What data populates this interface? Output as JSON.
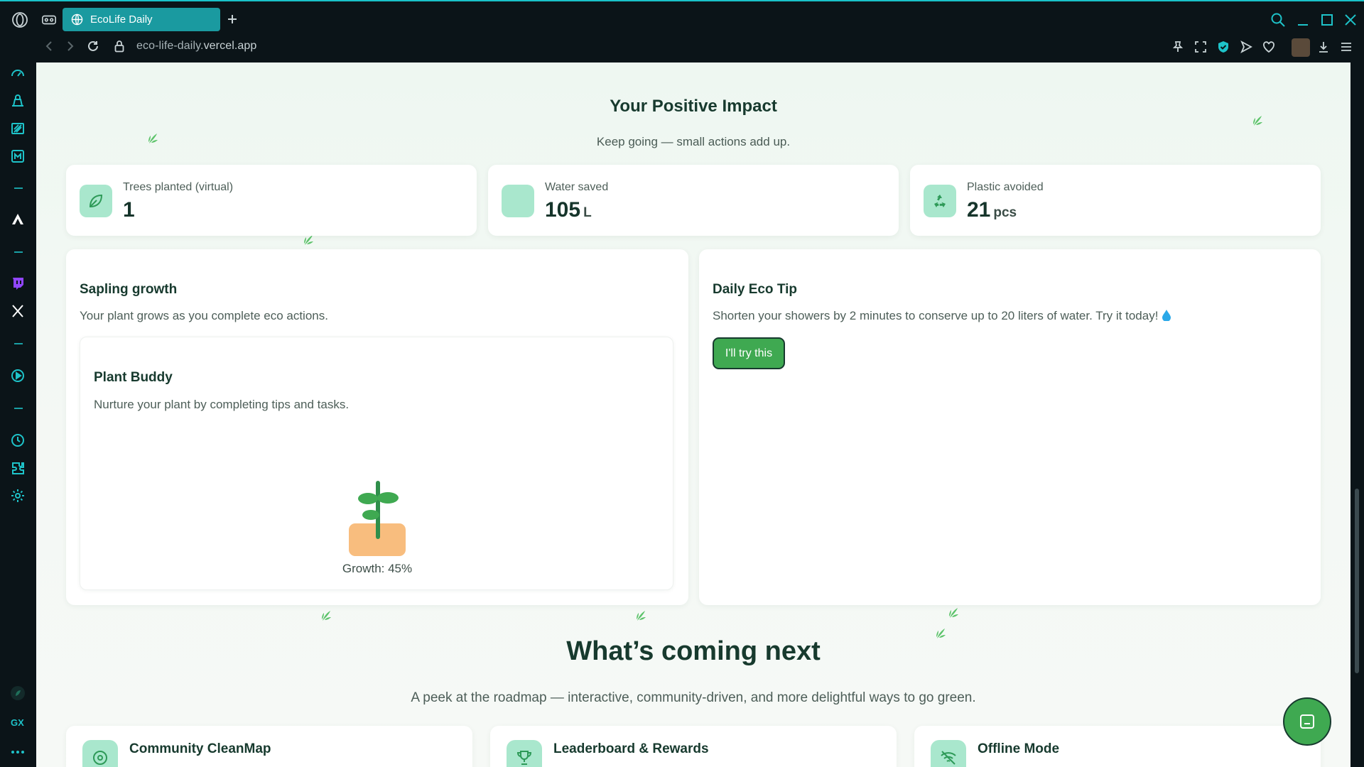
{
  "browser": {
    "tab_title": "EcoLife Daily",
    "url_host": "eco-life-daily.",
    "url_rest": "vercel.app"
  },
  "impact": {
    "title": "Your Positive Impact",
    "subtitle": "Keep going — small actions add up.",
    "stats": [
      {
        "label": "Trees planted (virtual)",
        "value": "1",
        "unit": "",
        "icon": "leaf-icon"
      },
      {
        "label": "Water saved",
        "value": "105",
        "unit": "L",
        "icon": "water-icon"
      },
      {
        "label": "Plastic avoided",
        "value": "21",
        "unit": "pcs",
        "icon": "recycle-icon"
      }
    ]
  },
  "sapling": {
    "title": "Sapling growth",
    "subtitle": "Your plant grows as you complete eco actions.",
    "buddy": {
      "title": "Plant Buddy",
      "subtitle": "Nurture your plant by completing tips and tasks.",
      "growth_label": "Growth: 45%",
      "growth_percent": 45
    }
  },
  "tip": {
    "title": "Daily Eco Tip",
    "text": "Shorten your showers by 2 minutes to conserve up to 20 liters of water. Try it today!",
    "button_label": "I'll try this"
  },
  "roadmap": {
    "title": "What’s coming next",
    "subtitle": "A peek at the roadmap — interactive, community-driven, and more delightful ways to go green.",
    "items": [
      {
        "title": "Community CleanMap",
        "icon": "map-pin-icon"
      },
      {
        "title": "Leaderboard & Rewards",
        "icon": "trophy-icon"
      },
      {
        "title": "Offline Mode",
        "icon": "wifi-off-icon"
      }
    ]
  },
  "colors": {
    "accent": "#19c2c9",
    "brand_green": "#3fa951",
    "mint": "#a9e7cd",
    "dark_text": "#173a2e"
  }
}
